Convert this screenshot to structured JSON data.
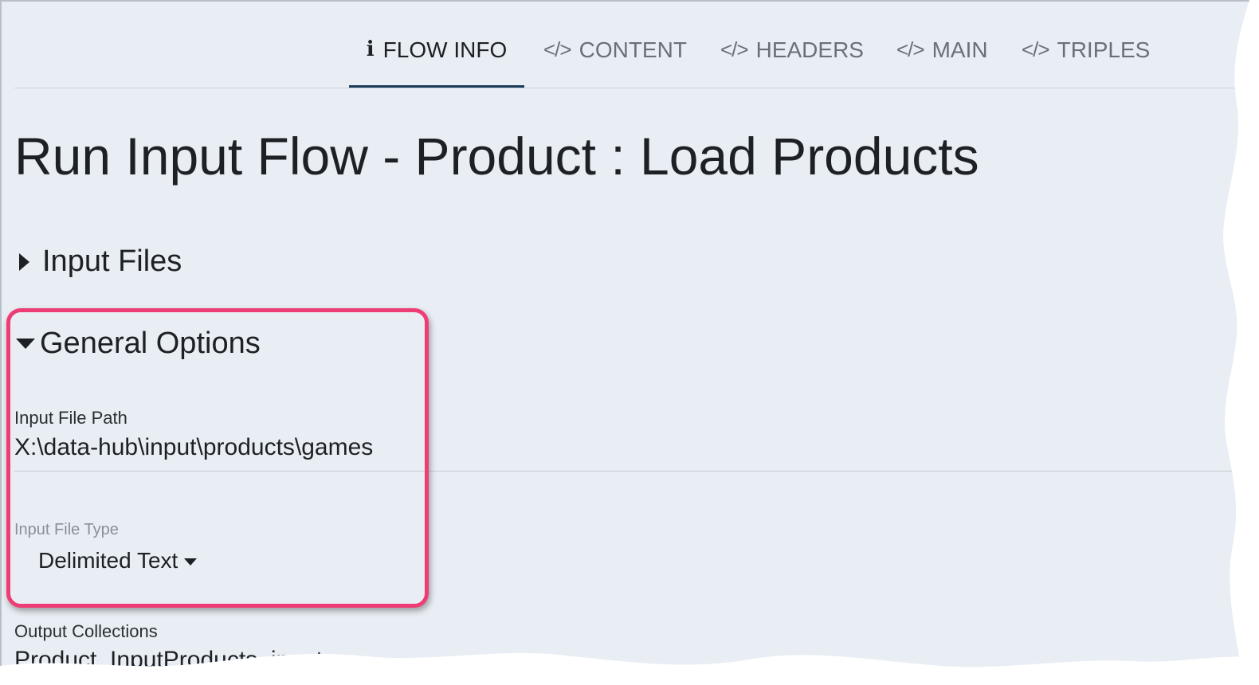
{
  "tabs": [
    {
      "icon": "info-icon",
      "glyph": "i",
      "label": "FLOW INFO",
      "active": true
    },
    {
      "icon": "code-icon",
      "glyph": "</>",
      "label": "CONTENT"
    },
    {
      "icon": "code-icon",
      "glyph": "</>",
      "label": "HEADERS"
    },
    {
      "icon": "code-icon",
      "glyph": "</>",
      "label": "MAIN"
    },
    {
      "icon": "code-icon",
      "glyph": "</>",
      "label": "TRIPLES"
    }
  ],
  "page_title": "Run Input Flow - Product : Load Products",
  "sections": {
    "input_files": {
      "label": "Input Files",
      "expanded": false,
      "icon": "caret-right-icon"
    },
    "general_options": {
      "label": "General Options",
      "expanded": true,
      "icon": "caret-down-icon"
    }
  },
  "fields": {
    "input_file_path": {
      "label": "Input File Path",
      "value": "X:\\data-hub\\input\\products\\games"
    },
    "input_file_type": {
      "label": "Input File Type",
      "value": "Delimited Text"
    },
    "output_collections": {
      "label": "Output Collections",
      "value_partial": "Product, InputProducts, input"
    }
  },
  "colors": {
    "page_bg": "#e9eef4",
    "highlight": "#ee3d74",
    "active_tab_underline": "#1b3b5a",
    "text": "#1d2125"
  }
}
